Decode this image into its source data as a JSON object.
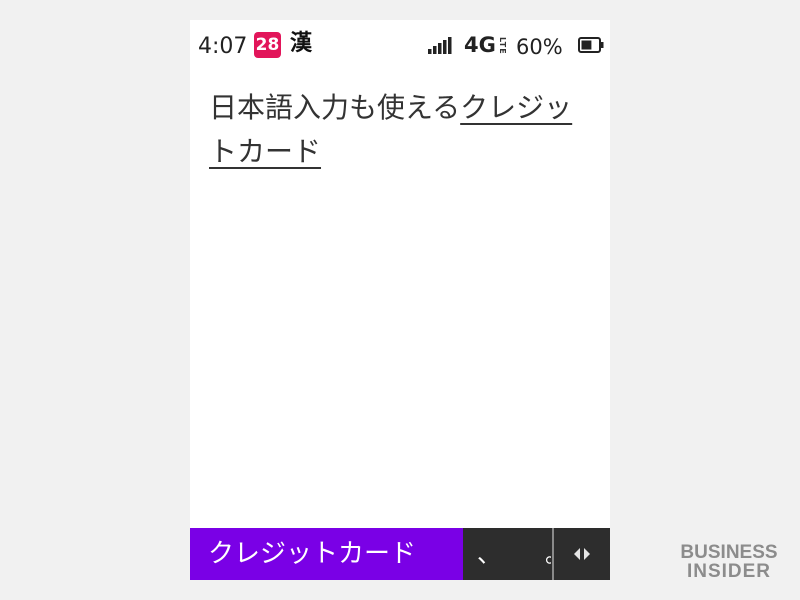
{
  "status_bar": {
    "time": "4:07",
    "notification_count": "28",
    "ime_mode": "漢",
    "network": "4G",
    "network_sub": "LTE",
    "battery_percent": "60%",
    "battery_level": 0.6
  },
  "editor": {
    "committed_text": "日本語入力も使える",
    "composing_text": "クレジットカード"
  },
  "candidate_bar": {
    "selected_candidate": "クレジットカード",
    "next_candidate": "、",
    "next_candidate_2": "。",
    "arrows_icon": "left-right-arrows-icon",
    "selected_color": "#7a00e6"
  },
  "watermark": {
    "line1": "BUSINESS",
    "line2": "INSIDER"
  }
}
